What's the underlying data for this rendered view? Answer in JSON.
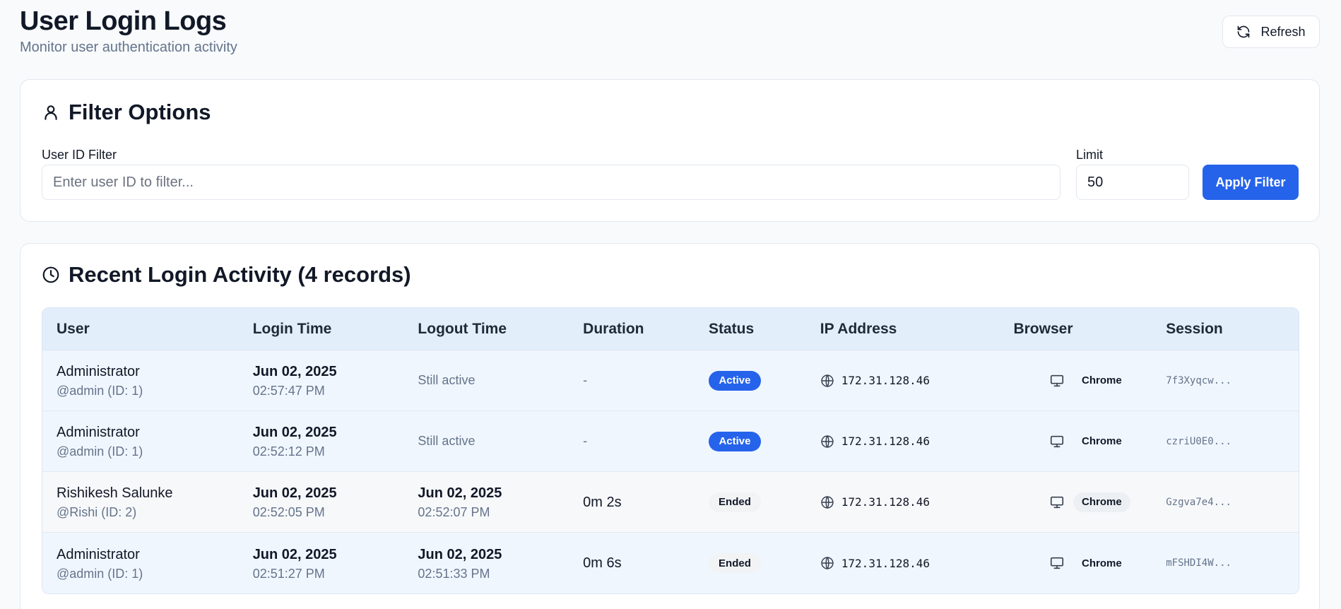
{
  "header": {
    "title": "User Login Logs",
    "subtitle": "Monitor user authentication activity",
    "refresh_label": "Refresh"
  },
  "filter": {
    "title": "Filter Options",
    "user_id_label": "User ID Filter",
    "user_id_placeholder": "Enter user ID to filter...",
    "limit_label": "Limit",
    "limit_value": "50",
    "apply_label": "Apply Filter"
  },
  "activity": {
    "title": "Recent Login Activity (4 records)",
    "columns": [
      "User",
      "Login Time",
      "Logout Time",
      "Duration",
      "Status",
      "IP Address",
      "Browser",
      "Session"
    ],
    "rows": [
      {
        "user_name": "Administrator",
        "user_handle": "@admin (ID: 1)",
        "login_date": "Jun 02, 2025",
        "login_time": "02:57:47 PM",
        "logout_text": "Still active",
        "duration": "-",
        "status": "Active",
        "ip": "172.31.128.46",
        "browser": "Chrome",
        "session": "7f3Xyqcw..."
      },
      {
        "user_name": "Administrator",
        "user_handle": "@admin (ID: 1)",
        "login_date": "Jun 02, 2025",
        "login_time": "02:52:12 PM",
        "logout_text": "Still active",
        "duration": "-",
        "status": "Active",
        "ip": "172.31.128.46",
        "browser": "Chrome",
        "session": "czriU0E0..."
      },
      {
        "user_name": "Rishikesh Salunke",
        "user_handle": "@Rishi (ID: 2)",
        "login_date": "Jun 02, 2025",
        "login_time": "02:52:05 PM",
        "logout_date": "Jun 02, 2025",
        "logout_time": "02:52:07 PM",
        "duration": "0m 2s",
        "status": "Ended",
        "ip": "172.31.128.46",
        "browser": "Chrome",
        "session": "Gzgva7e4..."
      },
      {
        "user_name": "Administrator",
        "user_handle": "@admin (ID: 1)",
        "login_date": "Jun 02, 2025",
        "login_time": "02:51:27 PM",
        "logout_date": "Jun 02, 2025",
        "logout_time": "02:51:33 PM",
        "duration": "0m 6s",
        "status": "Ended",
        "ip": "172.31.128.46",
        "browser": "Chrome",
        "session": "mFSHDI4W..."
      }
    ]
  },
  "icons": {
    "refresh": "refresh-icon",
    "filter_section": "user-icon",
    "activity_section": "clock-icon",
    "ip": "globe-icon",
    "browser": "monitor-icon"
  },
  "colors": {
    "accent": "#2563eb",
    "table_header_bg": "#e3eefb",
    "muted_text": "#64748b"
  }
}
